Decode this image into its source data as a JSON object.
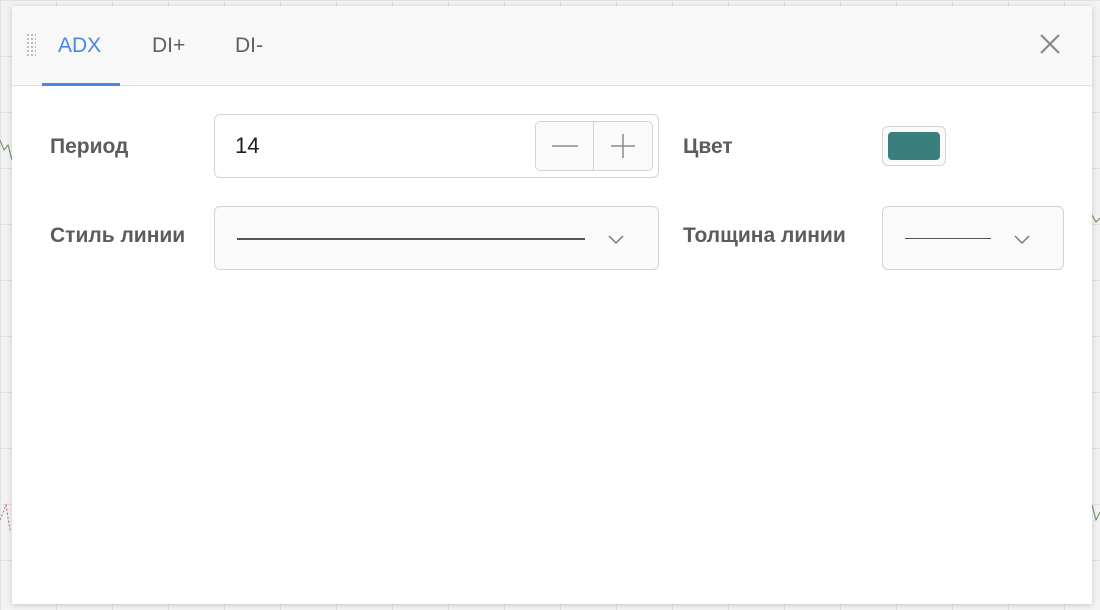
{
  "tabs": [
    {
      "label": "ADX",
      "active": true
    },
    {
      "label": "DI+",
      "active": false
    },
    {
      "label": "DI-",
      "active": false
    }
  ],
  "form": {
    "period": {
      "label": "Период",
      "value": "14"
    },
    "color": {
      "label": "Цвет",
      "value": "#3a7f7d"
    },
    "line_style": {
      "label": "Стиль линии",
      "selected": "solid"
    },
    "line_width": {
      "label": "Толщина линии",
      "selected": "1"
    }
  },
  "icons": {
    "drag": "drag-handle-icon",
    "close": "close-icon",
    "minus": "minus-icon",
    "plus": "plus-icon",
    "chevron": "chevron-down-icon"
  },
  "colors": {
    "accent": "#4a86e8",
    "text": "#5c5c5c",
    "border": "#d4d4d4"
  }
}
